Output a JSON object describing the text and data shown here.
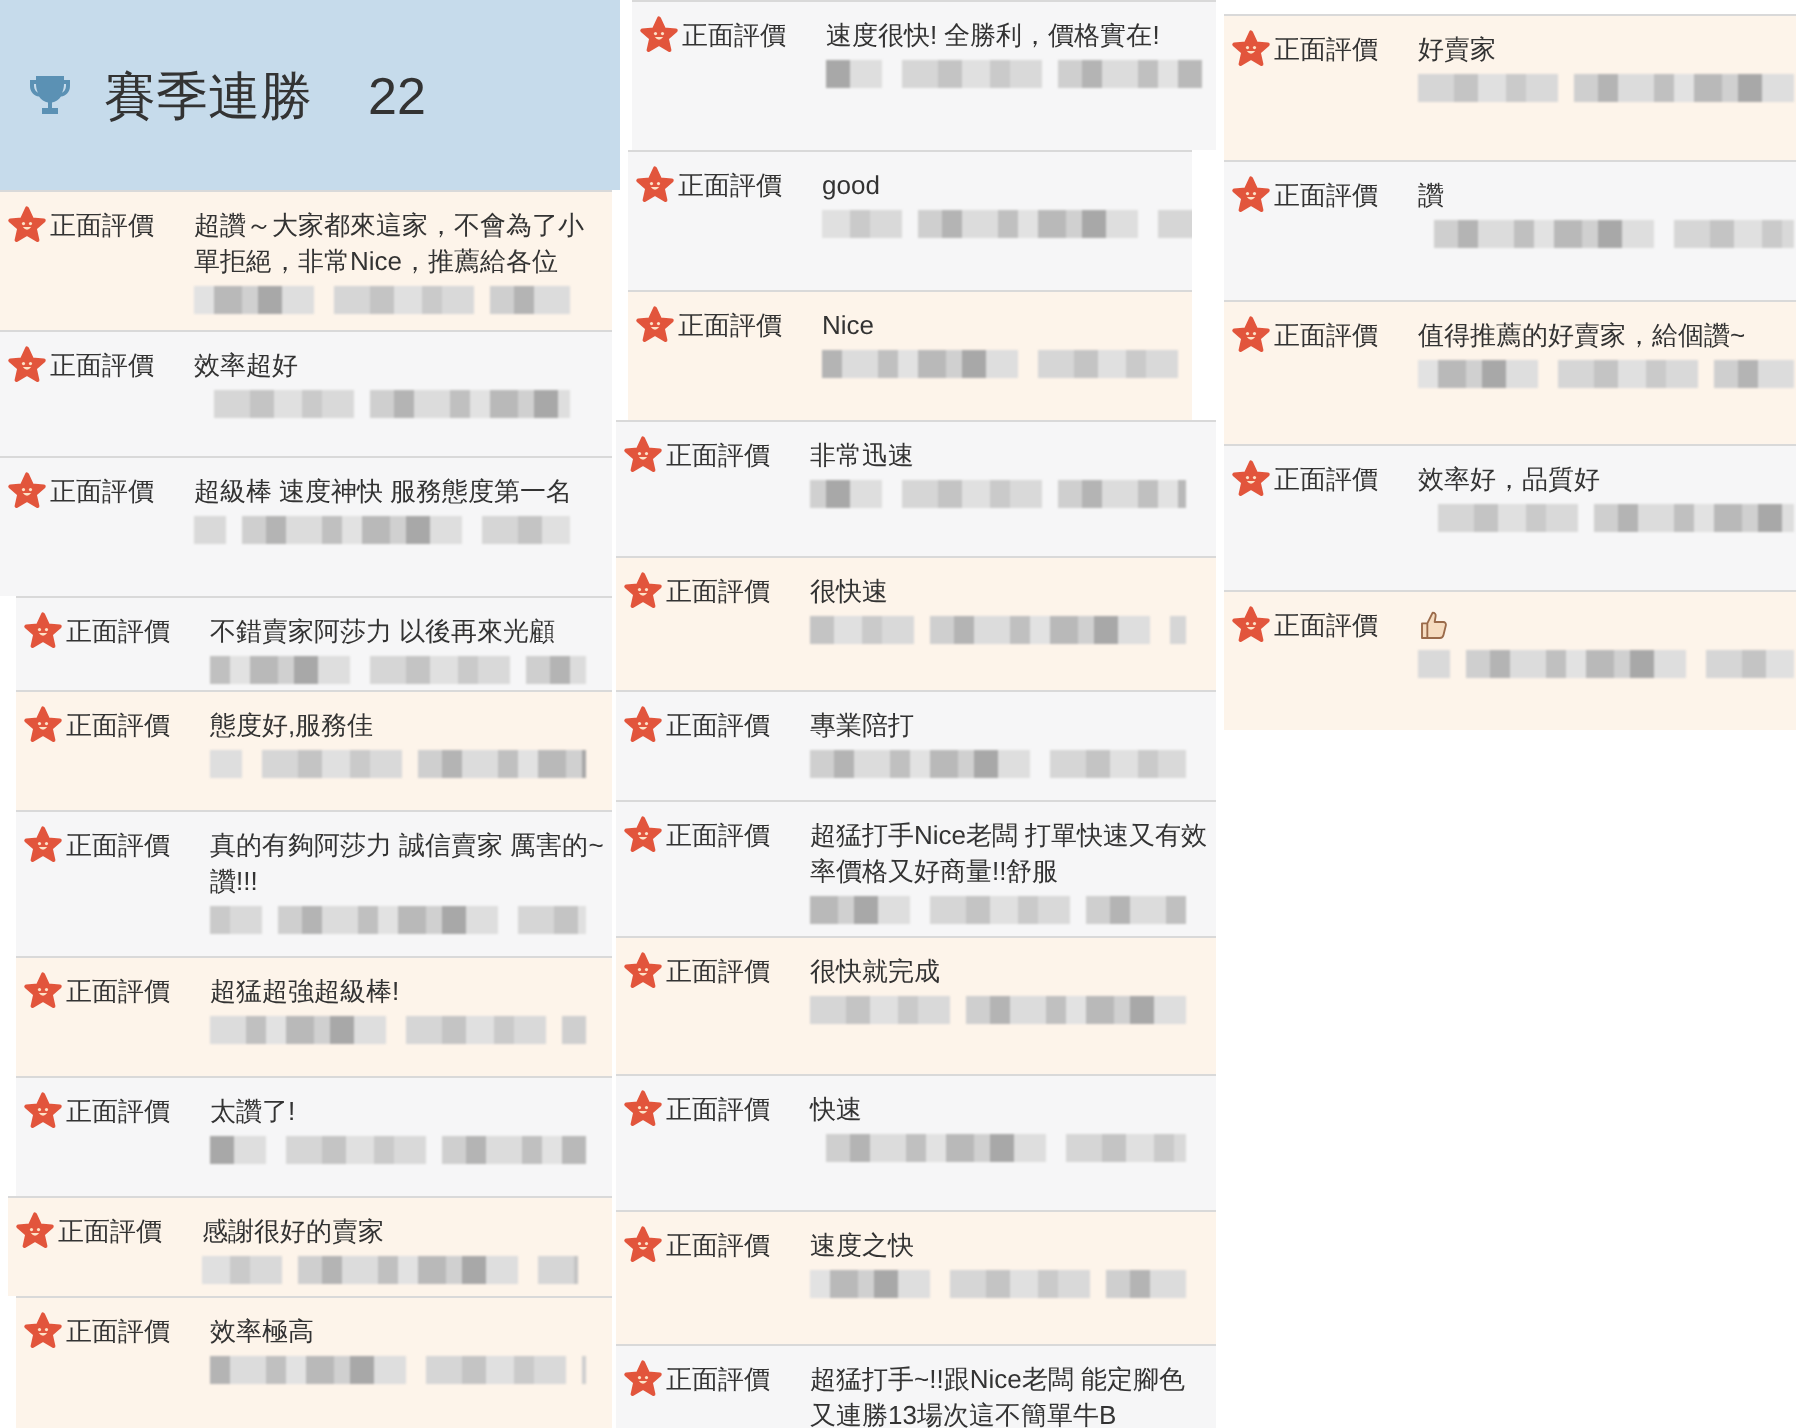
{
  "header": {
    "title": "賽季連勝",
    "count": "22"
  },
  "columns": [
    {
      "reviews": [
        {
          "rating": "正面評價",
          "kind": "text",
          "comment": "超讚～大家都來這家，不會為了小單拒絕，非常Nice，推薦給各位",
          "shaded": true
        },
        {
          "rating": "正面評價",
          "kind": "text",
          "comment": "效率超好",
          "shaded": false
        },
        {
          "rating": "正面評價",
          "kind": "text",
          "comment": "超級棒 速度神快 服務態度第一名",
          "shaded": false
        },
        {
          "rating": "正面評價",
          "kind": "text",
          "comment": "不錯賣家阿莎力 以後再來光顧",
          "shaded": false
        },
        {
          "rating": "正面評價",
          "kind": "text",
          "comment": "態度好,服務佳",
          "shaded": true
        },
        {
          "rating": "正面評價",
          "kind": "text",
          "comment": "真的有夠阿莎力 誠信賣家 厲害的~讚!!!",
          "shaded": false
        },
        {
          "rating": "正面評價",
          "kind": "text",
          "comment": "超猛超強超級棒!",
          "shaded": true
        },
        {
          "rating": "正面評價",
          "kind": "text",
          "comment": "太讚了!",
          "shaded": false
        },
        {
          "rating": "正面評價",
          "kind": "text",
          "comment": "感謝很好的賣家",
          "shaded": true
        },
        {
          "rating": "正面評價",
          "kind": "text",
          "comment": "效率極高",
          "shaded": true
        }
      ]
    },
    {
      "reviews": [
        {
          "rating": "正面評價",
          "kind": "text",
          "comment": "速度很快! 全勝利，價格實在!",
          "shaded": false
        },
        {
          "rating": "正面評價",
          "kind": "text",
          "comment": "good",
          "shaded": false
        },
        {
          "rating": "正面評價",
          "kind": "text",
          "comment": "Nice",
          "shaded": true
        },
        {
          "rating": "正面評價",
          "kind": "text",
          "comment": "非常迅速",
          "shaded": false
        },
        {
          "rating": "正面評價",
          "kind": "text",
          "comment": "很快速",
          "shaded": true
        },
        {
          "rating": "正面評價",
          "kind": "text",
          "comment": "專業陪打",
          "shaded": false
        },
        {
          "rating": "正面評價",
          "kind": "text",
          "comment": "超猛打手Nice老闆 打單快速又有效率價格又好商量!!舒服",
          "shaded": false
        },
        {
          "rating": "正面評價",
          "kind": "text",
          "comment": "很快就完成",
          "shaded": true
        },
        {
          "rating": "正面評價",
          "kind": "text",
          "comment": "快速",
          "shaded": false
        },
        {
          "rating": "正面評價",
          "kind": "text",
          "comment": "速度之快",
          "shaded": true
        },
        {
          "rating": "正面評價",
          "kind": "text",
          "comment": "超猛打手~!!跟Nice老闆 能定腳色又連勝13場次這不簡單牛B",
          "shaded": false
        }
      ]
    },
    {
      "reviews": [
        {
          "rating": "正面評價",
          "kind": "text",
          "comment": "好賣家",
          "shaded": true
        },
        {
          "rating": "正面評價",
          "kind": "text",
          "comment": "讚",
          "shaded": false
        },
        {
          "rating": "正面評價",
          "kind": "text",
          "comment": "值得推薦的好賣家，給個讚~",
          "shaded": true
        },
        {
          "rating": "正面評價",
          "kind": "text",
          "comment": "效率好，品質好",
          "shaded": false
        },
        {
          "rating": "正面評價",
          "kind": "icon",
          "shaded": true
        }
      ]
    }
  ]
}
